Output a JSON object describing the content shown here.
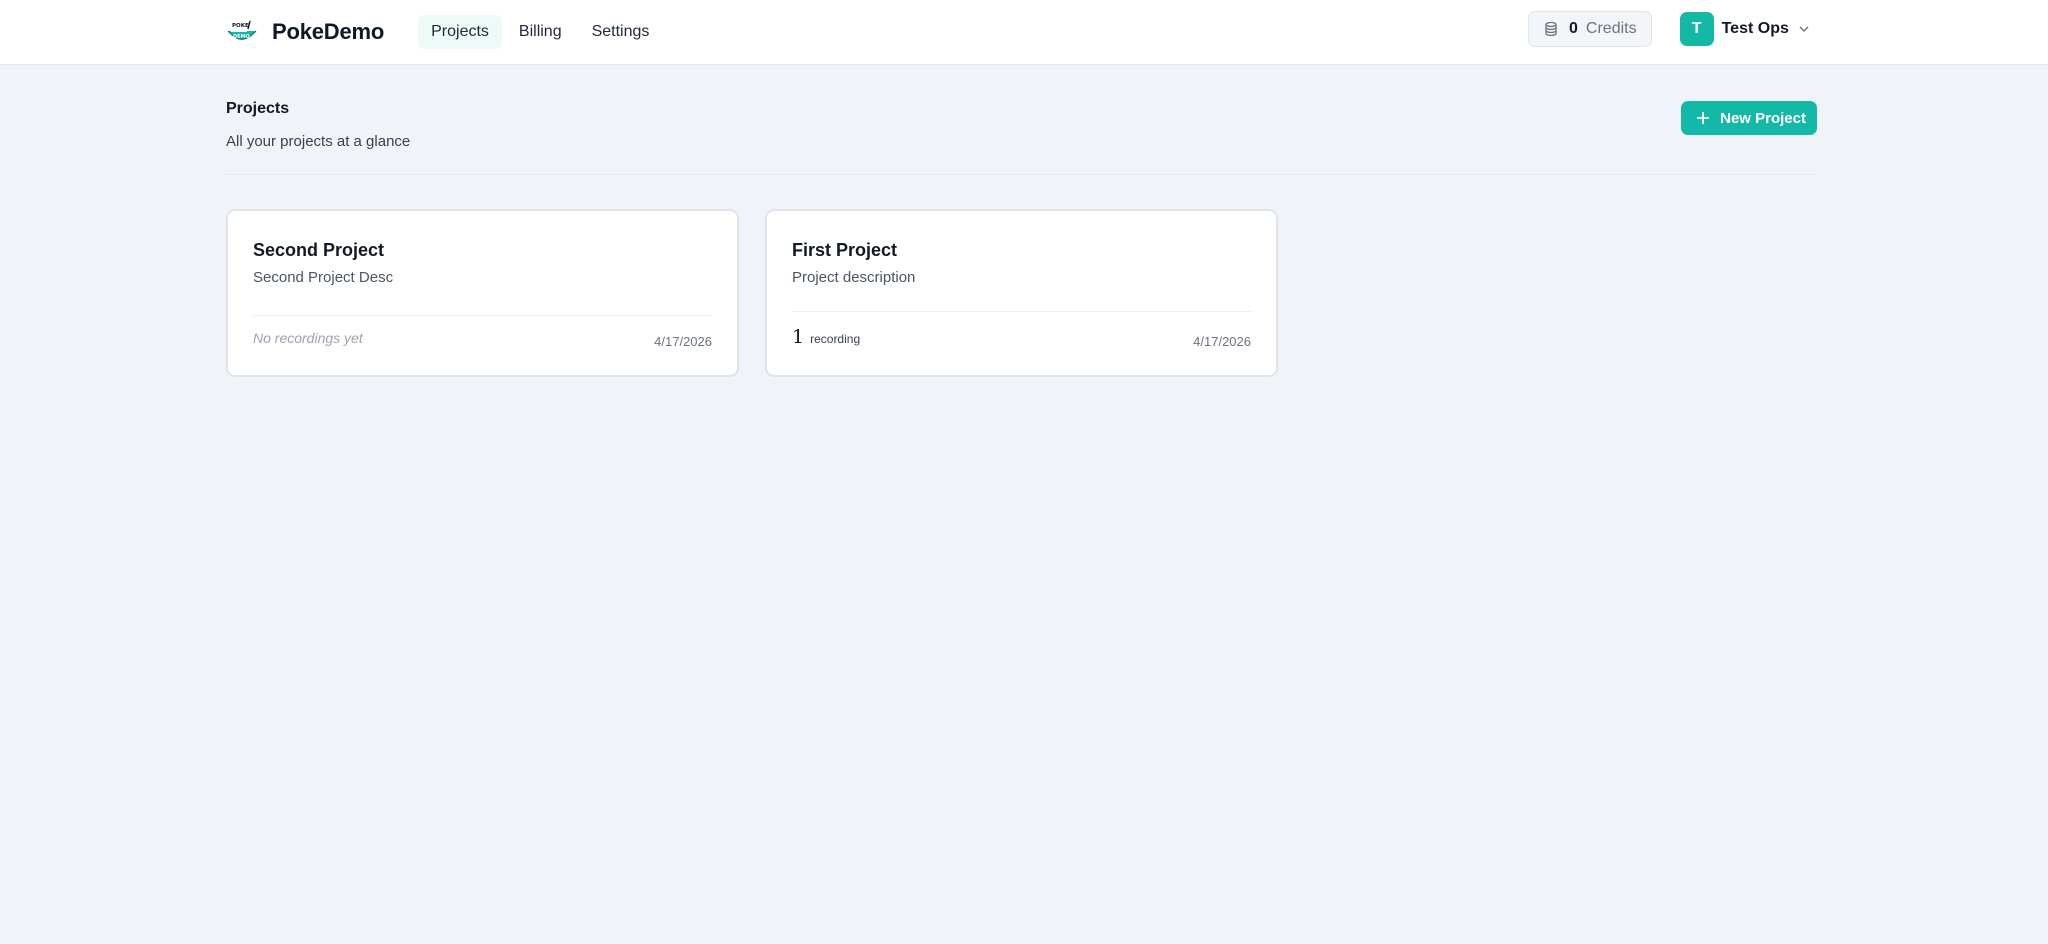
{
  "app": {
    "logo_text": "PokeDemo",
    "logo_badge_top": "POKE",
    "logo_badge_bottom": "DEMO",
    "accent_color": "#14b8a6"
  },
  "nav": {
    "items": [
      {
        "label": "Projects",
        "active": true
      },
      {
        "label": "Billing",
        "active": false
      },
      {
        "label": "Settings",
        "active": false
      }
    ]
  },
  "credits": {
    "icon": "coins-icon",
    "value": "0",
    "label": "Credits"
  },
  "user": {
    "initial": "T",
    "name": "Test Ops",
    "icon": "chevron-down-icon"
  },
  "page": {
    "title": "Projects",
    "subtitle": "All your projects at a glance",
    "new_project_label": "New Project",
    "new_project_icon": "plus-icon"
  },
  "projects": [
    {
      "title": "Second Project",
      "description": "Second Project Desc",
      "recordings_text": "No recordings yet",
      "date": "4/17/2026"
    },
    {
      "title": "First Project",
      "description": "Project description",
      "recordings_count": "1",
      "recordings_unit": "recording",
      "date": "4/17/2026"
    }
  ]
}
